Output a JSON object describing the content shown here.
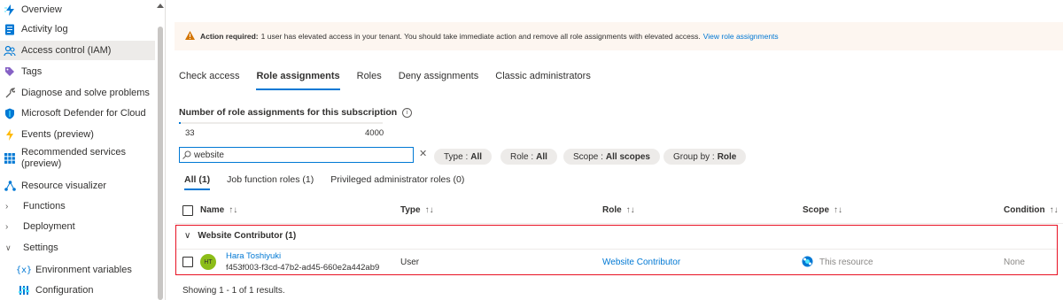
{
  "sidebar": {
    "items": [
      {
        "label": "Overview",
        "icon": "lightning-icon"
      },
      {
        "label": "Activity log",
        "icon": "log-icon"
      },
      {
        "label": "Access control (IAM)",
        "icon": "people-icon",
        "active": true
      },
      {
        "label": "Tags",
        "icon": "tag-icon"
      },
      {
        "label": "Diagnose and solve problems",
        "icon": "wrench-icon"
      },
      {
        "label": "Microsoft Defender for Cloud",
        "icon": "shield-icon"
      },
      {
        "label": "Events (preview)",
        "icon": "bolt-icon"
      },
      {
        "label": "Recommended services (preview)",
        "icon": "grid-icon"
      },
      {
        "label": "Resource visualizer",
        "icon": "network-icon"
      },
      {
        "label": "Functions",
        "icon": "chevron-right-icon"
      },
      {
        "label": "Deployment",
        "icon": "chevron-right-icon"
      },
      {
        "label": "Settings",
        "icon": "chevron-down-icon"
      },
      {
        "label": "Environment variables",
        "icon": "braces-icon"
      },
      {
        "label": "Configuration",
        "icon": "config-icon"
      }
    ]
  },
  "banner": {
    "title": "Action required:",
    "message": "1 user has elevated access in your tenant. You should take immediate action and remove all role assignments with elevated access.",
    "link": "View role assignments"
  },
  "tabs": [
    "Check access",
    "Role assignments",
    "Roles",
    "Deny assignments",
    "Classic administrators"
  ],
  "active_tab": "Role assignments",
  "assignment_count": {
    "title": "Number of role assignments for this subscription",
    "current": "33",
    "max": "4000",
    "fraction": 0.00825
  },
  "search": {
    "value": "website"
  },
  "filters": {
    "type_label": "Type :",
    "type_value": "All",
    "role_label": "Role :",
    "role_value": "All",
    "scope_label": "Scope :",
    "scope_value": "All scopes",
    "group_label": "Group by :",
    "group_value": "Role"
  },
  "subtabs": [
    "All (1)",
    "Job function roles (1)",
    "Privileged administrator roles (0)"
  ],
  "table": {
    "columns": [
      "Name",
      "Type",
      "Role",
      "Scope",
      "Condition"
    ],
    "group": "Website Contributor (1)",
    "row": {
      "initials": "HT",
      "name": "Hara Toshiyuki",
      "id": "f453f003-f3cd-47b2-ad45-660e2a442ab9",
      "type": "User",
      "role": "Website Contributor",
      "scope": "This resource",
      "condition": "None"
    }
  },
  "footer": "Showing 1 - 1 of 1 results.",
  "colors": {
    "accent": "#0078d4",
    "highlight": "#e81123",
    "warning": "#d47500",
    "avatar": "#8cbd18"
  }
}
